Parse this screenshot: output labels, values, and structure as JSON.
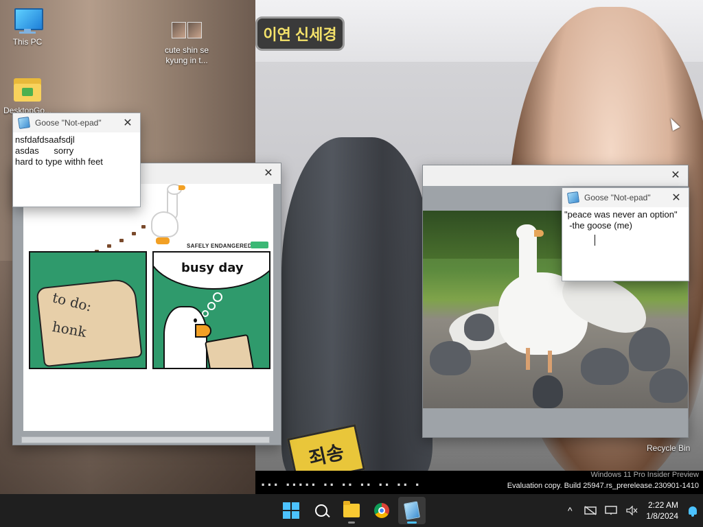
{
  "wallpaper": {
    "sign_top": "이연 신세경",
    "sign_bottom": "죄송",
    "strip_text": "··· ·····  ·· ·· ·· ·· ·· ·"
  },
  "watermark": {
    "line1": "Windows 11 Pro Insider Preview",
    "line2": "Evaluation copy. Build 25947.rs_prerelease.230901-1410"
  },
  "desktop_icons": {
    "this_pc": "This PC",
    "video": "cute shin se\nkyung in t...",
    "folder": "DesktopGo...",
    "recycle_bin": "Recycle Bin"
  },
  "note1": {
    "title": "Goose \"Not-epad\"",
    "text": "nsfdafdsaafsdjl\nasdas      sorry\nhard to type withh feet"
  },
  "note2": {
    "title": "Goose \"Not-epad\"",
    "text": "\"peace was never an option\"\n  -the goose (me)"
  },
  "comic": {
    "brand": "SAFELY ENDANGERED",
    "panel1_line1": "to do:",
    "panel1_line2": "honk",
    "panel2_caption": "busy day"
  },
  "taskbar": {
    "time": "2:22 AM",
    "date": "1/8/2024"
  },
  "colors": {
    "accent": "#4cc2ff",
    "taskbar": "#1f1f1f",
    "comic_green": "#2f9a6c",
    "goose_beak": "#f2a024"
  },
  "icons": {
    "start": "windows-logo-icon",
    "search": "search-icon",
    "explorer": "folder-icon",
    "chrome": "chrome-icon",
    "notepad": "notepad-icon",
    "chevron": "chevron-up-icon",
    "network": "network-disconnected-icon",
    "display": "display-icon",
    "volume": "volume-muted-icon",
    "bell": "notification-bell-icon"
  }
}
